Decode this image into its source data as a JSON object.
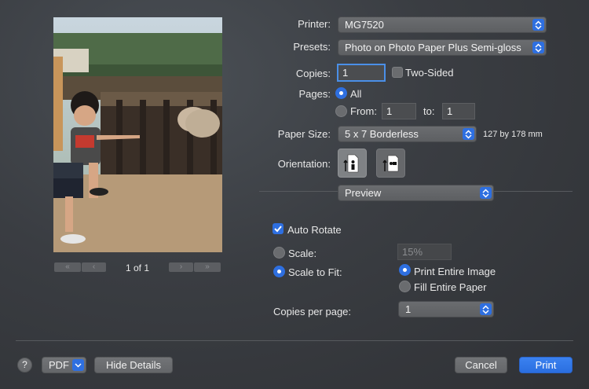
{
  "printer": {
    "label": "Printer:",
    "value": "MG7520"
  },
  "presets": {
    "label": "Presets:",
    "value": "Photo on Photo Paper Plus Semi-gloss"
  },
  "copies": {
    "label": "Copies:",
    "value": "1",
    "two_sided_label": "Two-Sided",
    "two_sided": false
  },
  "pages": {
    "label": "Pages:",
    "all_label": "All",
    "from_label": "From:",
    "from_value": "1",
    "to_label": "to:",
    "to_value": "1",
    "selected": "all"
  },
  "paper_size": {
    "label": "Paper Size:",
    "value": "5 x 7 Borderless",
    "dimensions": "127 by 178 mm"
  },
  "orientation": {
    "label": "Orientation:",
    "options": [
      "portrait-icon",
      "landscape-icon"
    ],
    "selected": "portrait"
  },
  "section": {
    "value": "Preview"
  },
  "auto_rotate": {
    "label": "Auto Rotate",
    "checked": true
  },
  "scale": {
    "label": "Scale:",
    "value": "15%"
  },
  "scale_to_fit": {
    "label": "Scale to Fit:",
    "selected": true,
    "print_entire_image": "Print Entire Image",
    "fill_entire_paper": "Fill Entire Paper",
    "fit_selected": "print_entire_image"
  },
  "copies_per_page": {
    "label": "Copies per page:",
    "value": "1"
  },
  "preview_nav": {
    "page_indicator": "1 of 1",
    "first": "«",
    "prev": "‹",
    "next": "›",
    "last": "»"
  },
  "footer": {
    "help": "?",
    "pdf": "PDF",
    "hide_details": "Hide Details",
    "cancel": "Cancel",
    "print": "Print"
  },
  "colors": {
    "accent": "#2e6fe0",
    "background": "#3a3d42"
  }
}
